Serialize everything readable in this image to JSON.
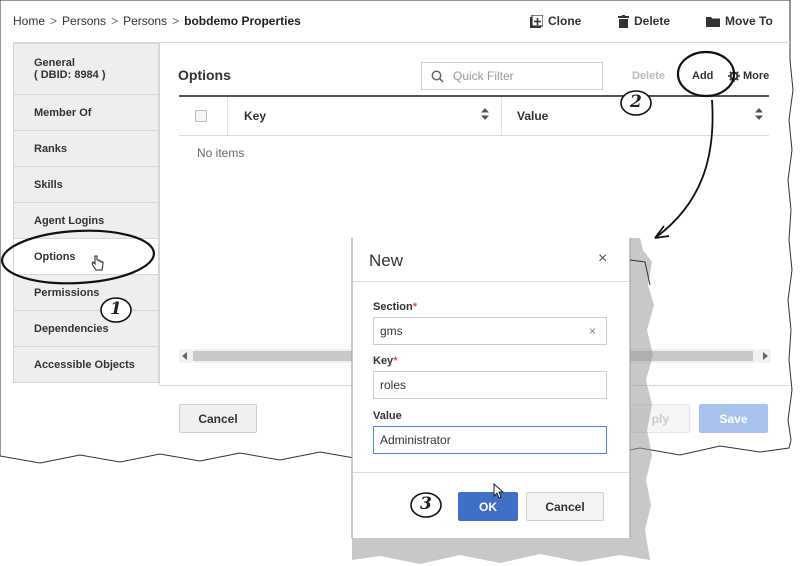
{
  "breadcrumb": {
    "items": [
      "Home",
      "Persons",
      "Persons"
    ],
    "separator": ">",
    "current": "bobdemo Properties"
  },
  "top_actions": {
    "clone": "Clone",
    "delete": "Delete",
    "move_to": "Move To"
  },
  "sidebar": {
    "items": [
      {
        "label": "General",
        "sub": "( DBID: 8984 )"
      },
      {
        "label": "Member Of"
      },
      {
        "label": "Ranks"
      },
      {
        "label": "Skills"
      },
      {
        "label": "Agent Logins"
      },
      {
        "label": "Options"
      },
      {
        "label": "Permissions"
      },
      {
        "label": "Dependencies"
      },
      {
        "label": "Accessible Objects"
      }
    ],
    "active": "Options"
  },
  "panel": {
    "title": "Options",
    "filter_placeholder": "Quick Filter",
    "delete_label": "Delete",
    "add_label": "Add",
    "more_label": "More"
  },
  "table": {
    "columns": [
      "Key",
      "Value"
    ],
    "empty_text": "No items"
  },
  "footer": {
    "cancel_label": "Cancel",
    "apply_label": "ply",
    "save_label": "Save"
  },
  "dialog": {
    "title": "New",
    "close_glyph": "×",
    "section_label": "Section",
    "section_value": "gms",
    "key_label": "Key",
    "key_value": "roles",
    "value_label": "Value",
    "value_value": "Administrator",
    "required_mark": "*",
    "ok_label": "OK",
    "cancel_label": "Cancel"
  },
  "callouts": [
    "1",
    "2",
    "3"
  ],
  "colors": {
    "primary": "#3f6fc7",
    "save_disabled": "#a7c2eb",
    "required": "#d9534f",
    "focus_border": "#4a86e8"
  }
}
